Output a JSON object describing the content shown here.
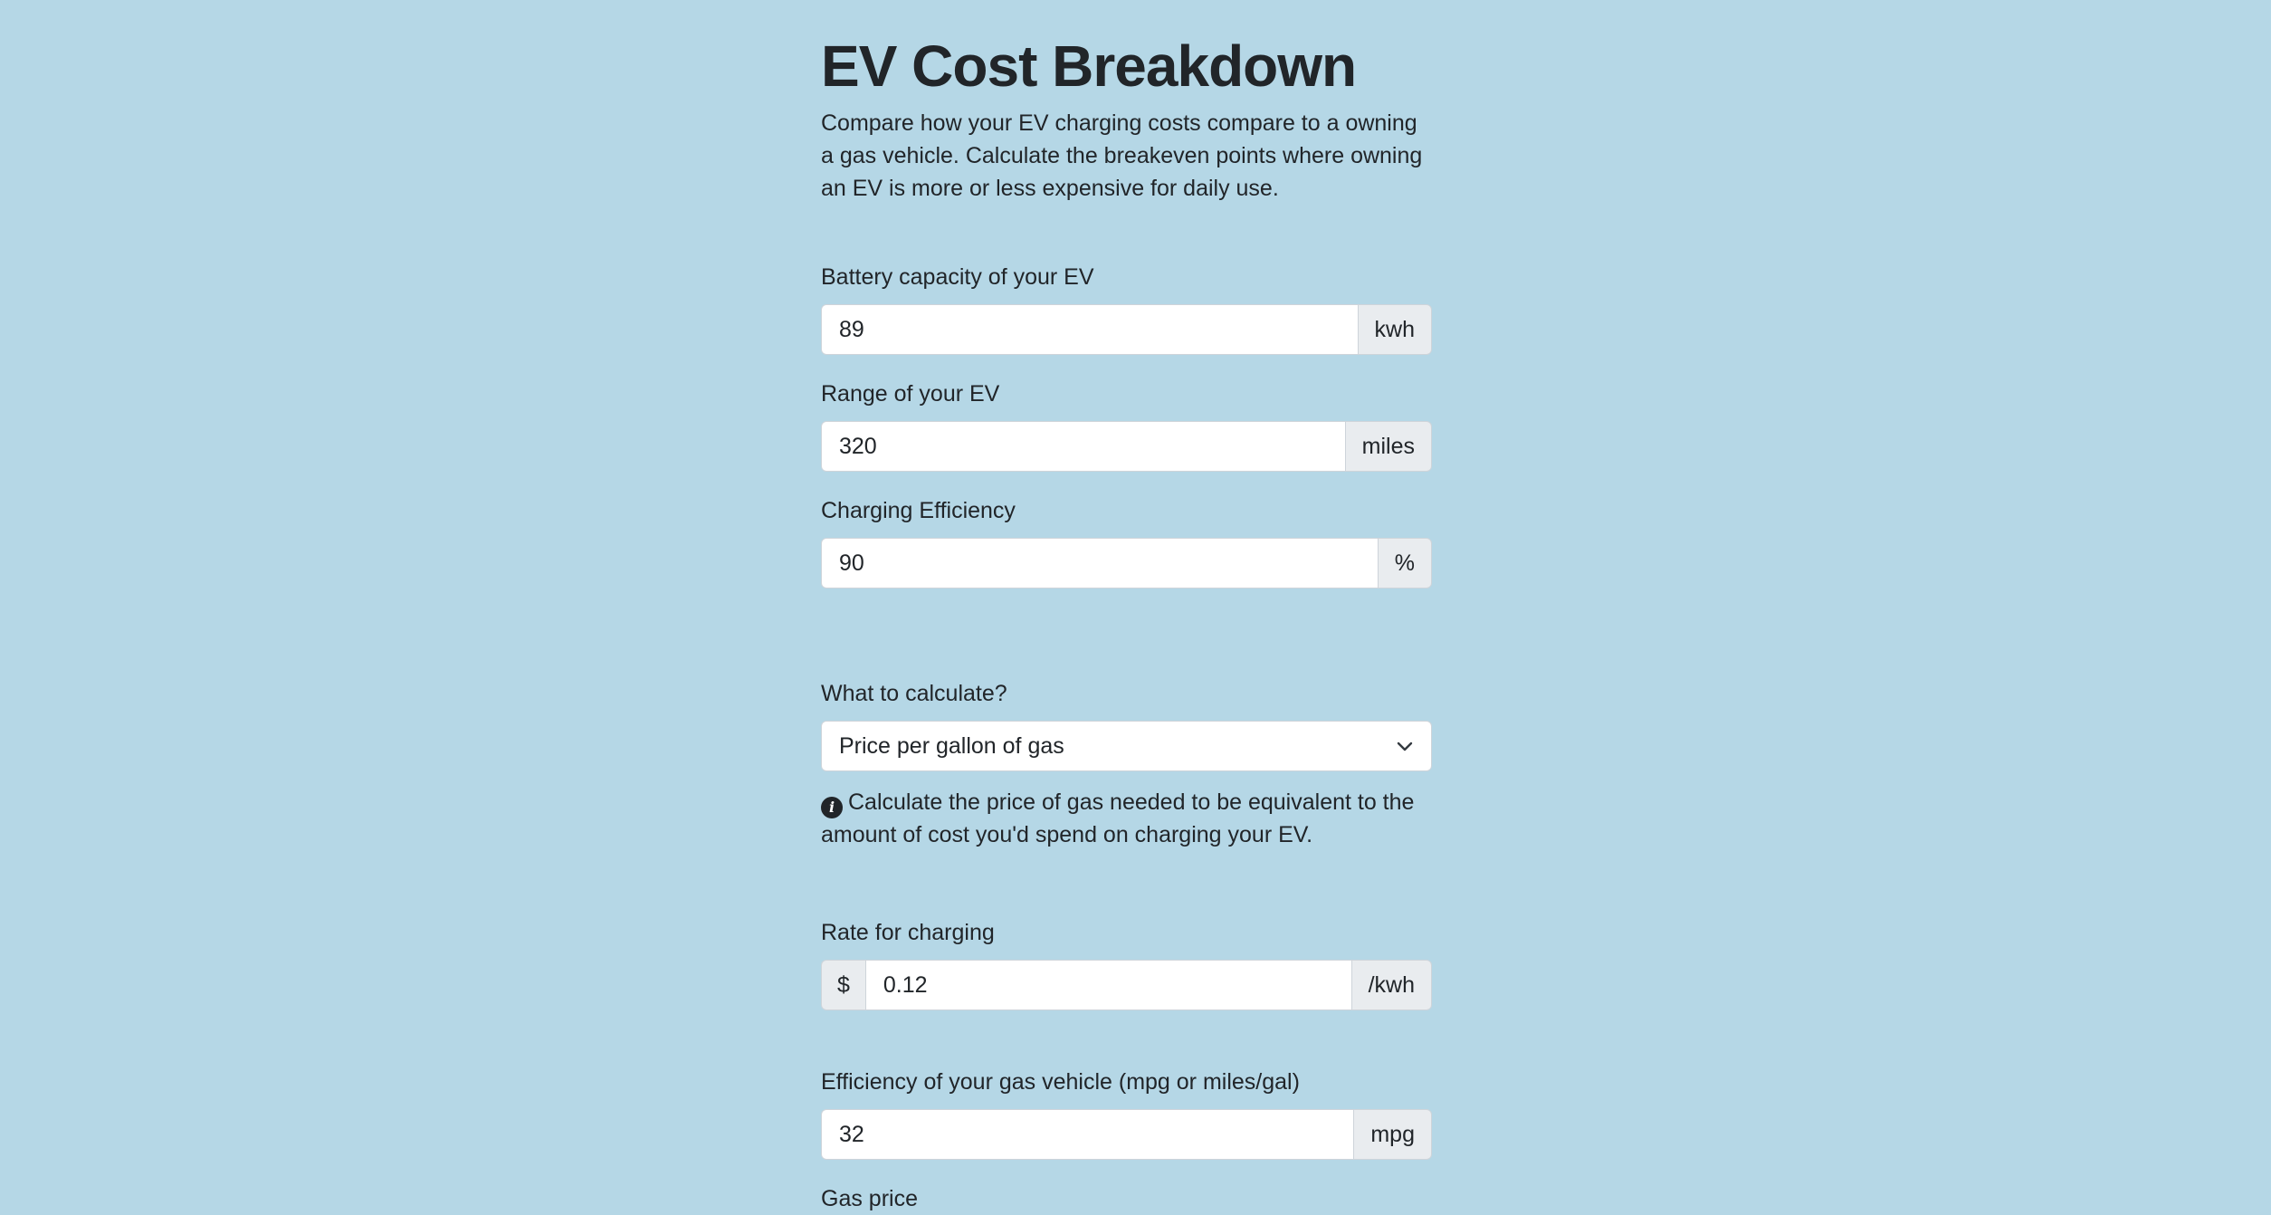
{
  "page": {
    "title": "EV Cost Breakdown",
    "description": "Compare how your EV charging costs compare to a owning a gas vehicle. Calculate the breakeven points where owning an EV is more or less expensive for daily use."
  },
  "ev": {
    "battery": {
      "label": "Battery capacity of your EV",
      "value": "89",
      "unit": "kwh"
    },
    "range": {
      "label": "Range of your EV",
      "value": "320",
      "unit": "miles"
    },
    "efficiency": {
      "label": "Charging Efficiency",
      "value": "90",
      "unit": "%"
    }
  },
  "calc": {
    "label": "What to calculate?",
    "selected": "Price per gallon of gas",
    "hint": "Calculate the price of gas needed to be equivalent to the amount of cost you'd spend on charging your EV.",
    "info_icon": "info-circle-icon",
    "chevron_icon": "chevron-down-icon"
  },
  "rate": {
    "label": "Rate for charging",
    "prefix": "$",
    "value": "0.12",
    "unit": "/kwh"
  },
  "gas_vehicle": {
    "label": "Efficiency of your gas vehicle (mpg or miles/gal)",
    "value": "32",
    "unit": "mpg"
  },
  "gas_price": {
    "label": "Gas price"
  }
}
